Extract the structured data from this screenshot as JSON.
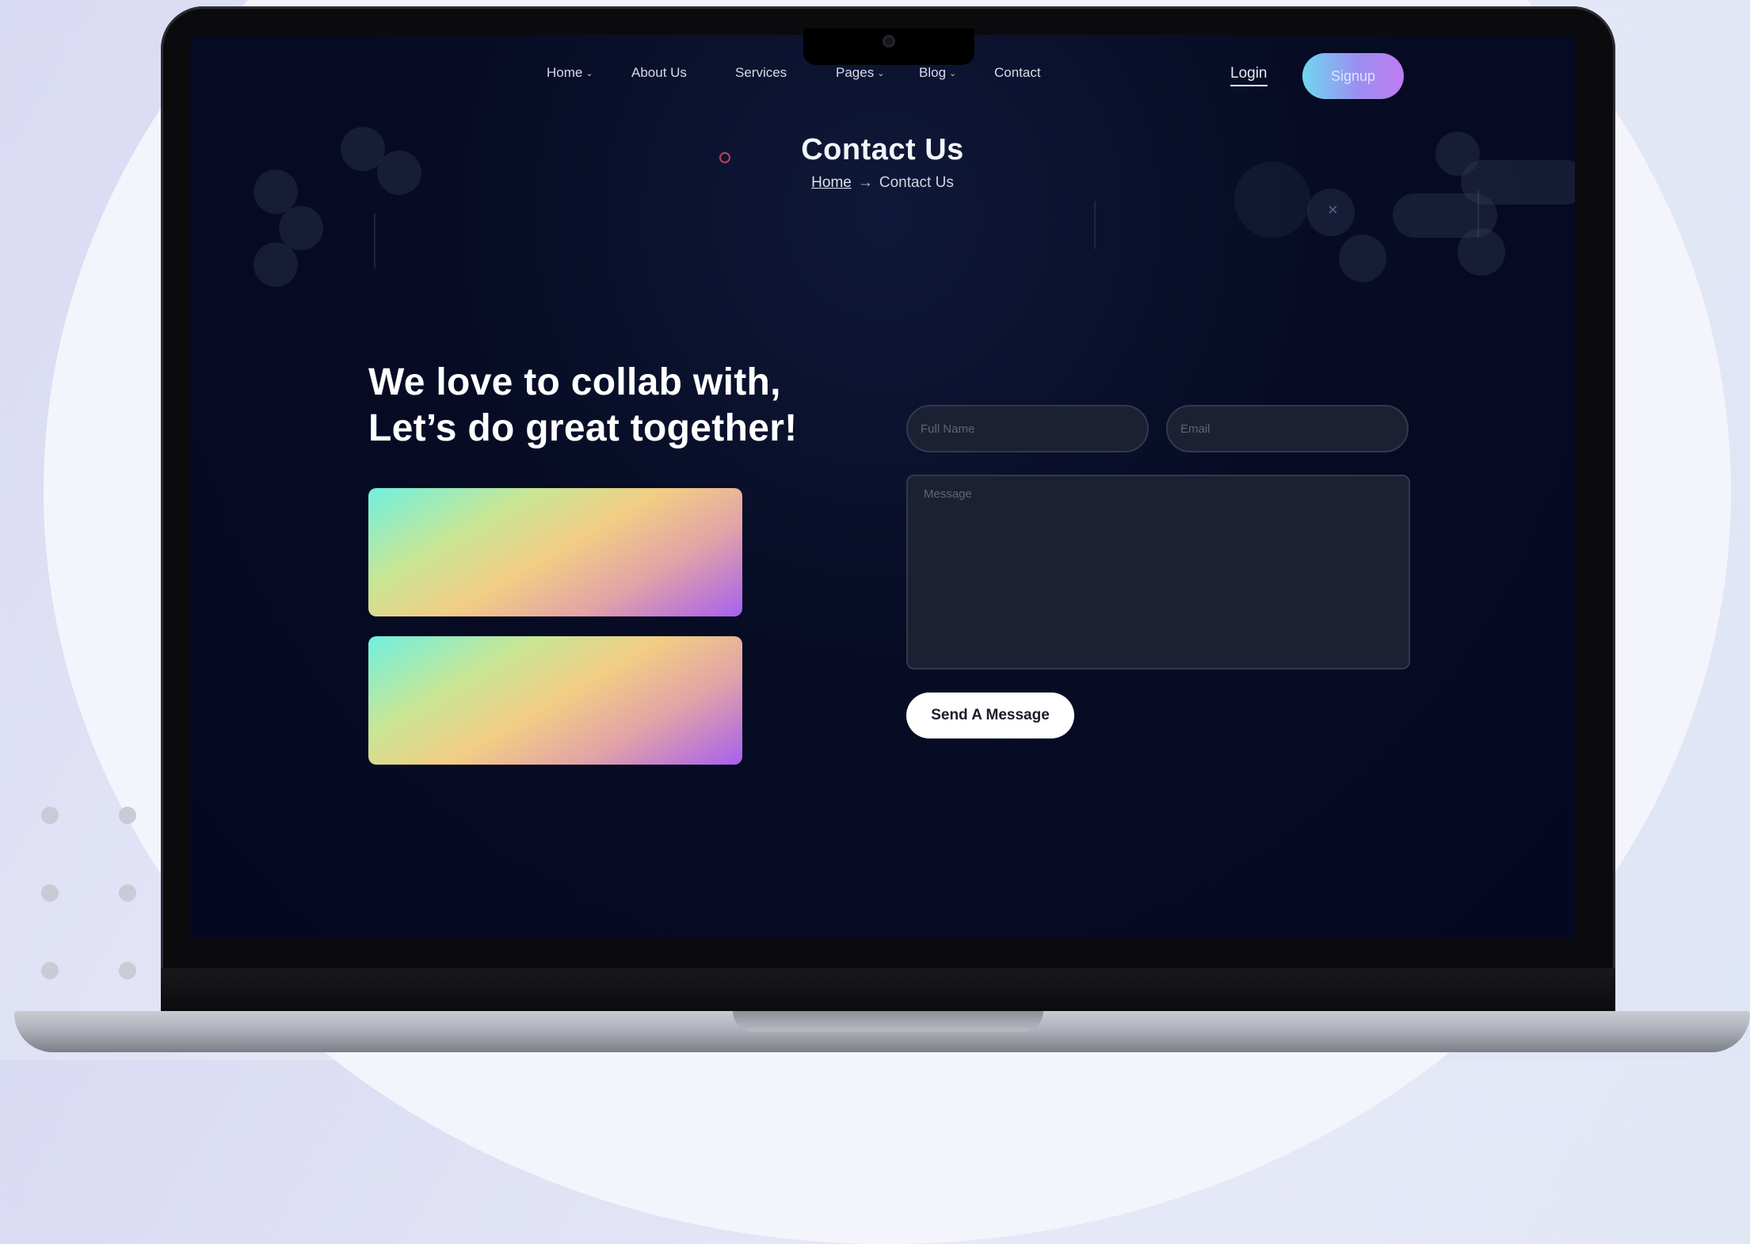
{
  "nav": {
    "items": [
      {
        "label": "Home",
        "has_dropdown": true
      },
      {
        "label": "About Us",
        "has_dropdown": false
      },
      {
        "label": "Services",
        "has_dropdown": false
      },
      {
        "label": "Pages",
        "has_dropdown": true
      },
      {
        "label": "Blog",
        "has_dropdown": true
      },
      {
        "label": "Contact",
        "has_dropdown": false
      }
    ],
    "login_label": "Login",
    "signup_label": "Signup",
    "dropdown_icon": "chevron-down-icon"
  },
  "hero": {
    "title": "Contact Us",
    "breadcrumb": {
      "home": "Home",
      "separator": "→",
      "current": "Contact Us"
    }
  },
  "contact": {
    "headline_line1": "We love to collab with,",
    "headline_line2": "Let’s do great together!",
    "form": {
      "full_name_placeholder": "Full Name",
      "email_placeholder": "Email",
      "message_placeholder": "Message",
      "submit_label": "Send A Message"
    }
  },
  "colors": {
    "screen_bg": "#040820",
    "accent_gradient_start": "#6fd7f0",
    "accent_gradient_end": "#c07cf2",
    "field_bg": "#1c2033"
  }
}
